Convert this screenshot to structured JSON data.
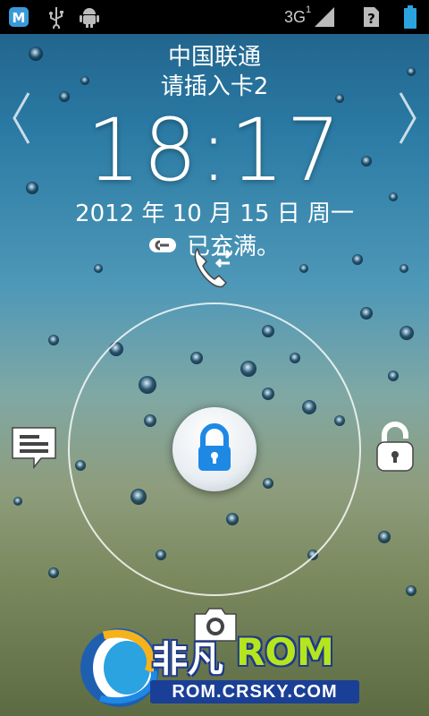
{
  "status_bar": {
    "network": "3G",
    "sim_index": "1",
    "icons": [
      "notification-m-icon",
      "usb-icon",
      "android-debug-icon",
      "signal-icon",
      "no-sim-icon",
      "battery-icon"
    ]
  },
  "lock_screen": {
    "carrier": "中国联通",
    "sim_message": "请插入卡2",
    "time": "18:17",
    "date": "2012 年 10 月 15 日 周一",
    "charge_status": "已充满。"
  },
  "targets": {
    "top": "phone-icon",
    "left": "message-icon",
    "right": "unlock-icon",
    "bottom": "camera-icon",
    "center": "lock-icon"
  },
  "watermark": {
    "brand_cn": "非凡",
    "brand_en": "ROM",
    "url": "ROM.CRSKY.COM"
  },
  "colors": {
    "accent_blue": "#1e88e5",
    "lime": "#b5e61d"
  }
}
